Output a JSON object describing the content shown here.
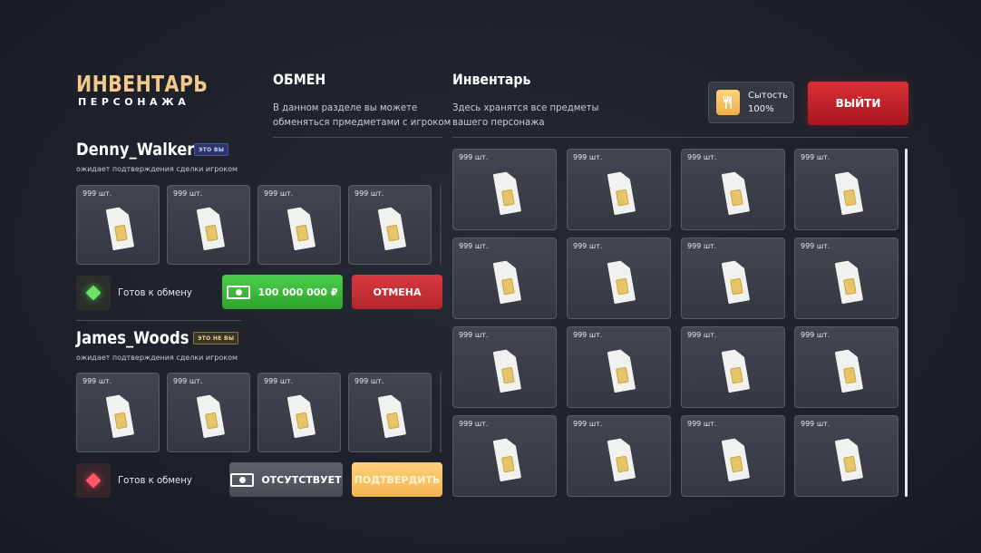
{
  "logo": {
    "title": "ИНВЕНТАРЬ",
    "subtitle": "ПЕРСОНАЖА"
  },
  "exchange": {
    "title": "ОБМЕН",
    "description_line1": "В данном разделе вы можете",
    "description_line2": "обменяться прмедметами с игроком"
  },
  "inventory": {
    "title": "Инвентарь",
    "description_line1": "Здесь хранятся все предметы",
    "description_line2": "вашего персонажа",
    "slots": [
      {
        "qty": "999 шт.",
        "icon": "sim-card-icon"
      },
      {
        "qty": "999 шт.",
        "icon": "sim-card-icon"
      },
      {
        "qty": "999 шт.",
        "icon": "sim-card-icon"
      },
      {
        "qty": "999 шт.",
        "icon": "sim-card-icon"
      },
      {
        "qty": "999 шт.",
        "icon": "sim-card-icon"
      },
      {
        "qty": "999 шт.",
        "icon": "sim-card-icon"
      },
      {
        "qty": "999 шт.",
        "icon": "sim-card-icon"
      },
      {
        "qty": "999 шт.",
        "icon": "sim-card-icon"
      },
      {
        "qty": "999 шт.",
        "icon": "sim-card-icon"
      },
      {
        "qty": "999 шт.",
        "icon": "sim-card-icon"
      },
      {
        "qty": "999 шт.",
        "icon": "sim-card-icon"
      },
      {
        "qty": "999 шт.",
        "icon": "sim-card-icon"
      },
      {
        "qty": "999 шт.",
        "icon": "sim-card-icon"
      },
      {
        "qty": "999 шт.",
        "icon": "sim-card-icon"
      },
      {
        "qty": "999 шт.",
        "icon": "sim-card-icon"
      },
      {
        "qty": "999 шт.",
        "icon": "sim-card-icon"
      }
    ]
  },
  "satiety": {
    "label": "Сытость",
    "value": "100%",
    "icon": "cutlery-icon"
  },
  "exit_button": "ВЫЙТИ",
  "players": [
    {
      "name": "Denny_Walker",
      "badge": "ЭТО ВЫ",
      "status": "ожидает подтверждения сделки игроком",
      "slots": [
        {
          "qty": "999 шт.",
          "icon": "sim-card-icon"
        },
        {
          "qty": "999 шт.",
          "icon": "sim-card-icon"
        },
        {
          "qty": "999 шт.",
          "icon": "sim-card-icon"
        },
        {
          "qty": "999 шт.",
          "icon": "sim-card-icon"
        }
      ],
      "ready_label": "Готов к обмену",
      "ready_state": "green",
      "money_label": "100 000 000 ₽",
      "action_label": "ОТМЕНА"
    },
    {
      "name": "James_Woods",
      "badge": "ЭТО НЕ ВЫ",
      "status": "ожидает подтверждения сделки игроком",
      "slots": [
        {
          "qty": "999 шт.",
          "icon": "sim-card-icon"
        },
        {
          "qty": "999 шт.",
          "icon": "sim-card-icon"
        },
        {
          "qty": "999 шт.",
          "icon": "sim-card-icon"
        },
        {
          "qty": "999 шт.",
          "icon": "sim-card-icon"
        }
      ],
      "ready_label": "Готов к обмену",
      "ready_state": "red",
      "money_label": "ОТСУТСТВУЕТ",
      "action_label": "ПОДТВЕРДИТЬ"
    }
  ],
  "colors": {
    "accent_gold": "#f2c98a",
    "green": "#3fbf3d",
    "red": "#c8303a",
    "yellow": "#f6bf5e"
  }
}
